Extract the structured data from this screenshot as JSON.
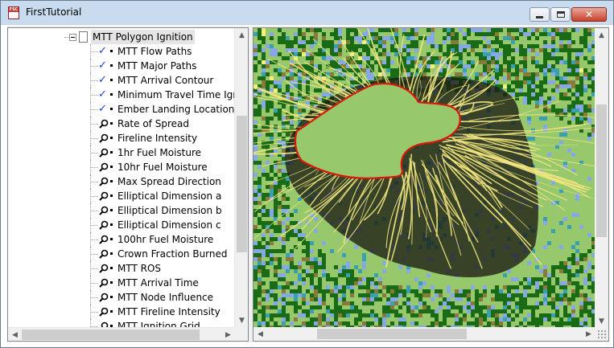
{
  "window": {
    "title": "FirstTutorial",
    "app_icon_text": "FSC",
    "buttons": {
      "minimize": "minimize",
      "maximize": "maximize",
      "close": "close"
    }
  },
  "tree": {
    "parent": {
      "label": "MTT Polygon Ignition",
      "expanded": true
    },
    "items": [
      {
        "label": "MTT Flow Paths",
        "state": "checked"
      },
      {
        "label": "MTT Major Paths",
        "state": "checked"
      },
      {
        "label": "MTT Arrival Contour",
        "state": "checked"
      },
      {
        "label": "Minimum Travel Time Igniti",
        "state": "checked"
      },
      {
        "label": "Ember Landing Locations",
        "state": "checked"
      },
      {
        "label": "Rate of Spread",
        "state": "view"
      },
      {
        "label": "Fireline Intensity",
        "state": "view"
      },
      {
        "label": "1hr Fuel Moisture",
        "state": "view"
      },
      {
        "label": "10hr Fuel Moisture",
        "state": "view"
      },
      {
        "label": "Max Spread Direction",
        "state": "view"
      },
      {
        "label": "Elliptical Dimension a",
        "state": "view"
      },
      {
        "label": "Elliptical Dimension b",
        "state": "view"
      },
      {
        "label": "Elliptical Dimension c",
        "state": "view"
      },
      {
        "label": "100hr Fuel Moisture",
        "state": "view"
      },
      {
        "label": "Crown Fraction Burned",
        "state": "view"
      },
      {
        "label": "MTT ROS",
        "state": "view"
      },
      {
        "label": "MTT Arrival Time",
        "state": "view"
      },
      {
        "label": "MTT Node Influence",
        "state": "view"
      },
      {
        "label": "MTT Fireline Intensity",
        "state": "view"
      },
      {
        "label": "MTT Ignition Grid",
        "state": "view"
      }
    ],
    "vscroll_position": 0.55,
    "hscroll_position": 0.0
  },
  "map": {
    "colors": {
      "grass": "#98c86c",
      "forest": "#1a6b16",
      "water": "#86a9e4",
      "shrub": "#8a7a3a",
      "teal": "#3a9fae",
      "yellow": "#f4f07a",
      "burned": "#1c1c12",
      "flowpath": "#f2e680",
      "perimeter": "#d81a0c"
    },
    "vscroll_position": 0.45,
    "hscroll_position": 0.3
  }
}
